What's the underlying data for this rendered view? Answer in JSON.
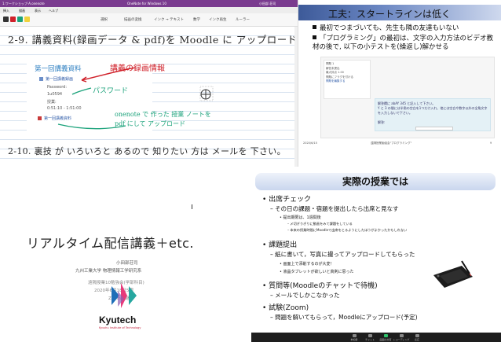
{
  "onenote": {
    "title_left": "1.ワークショップ-A.onenote",
    "title_mid": "OneNote for Windows 10",
    "title_right": "小田部 荘司",
    "menu": [
      "挿入",
      "描画",
      "表示",
      "ヘルプ"
    ],
    "ribbon": [
      "選択",
      "描画の変換",
      "インク → テキスト",
      "数学",
      "インク再生",
      "ルーラー"
    ],
    "handwriting_line1": "2-9. 講義資料(録画データ & pdf)を Moodle に アップロード",
    "handwriting_line2": "2-10. 裏技 が いろいろと あるので 知りたい 方は メールを 下さい。",
    "submission": {
      "title": "第一回講義資料",
      "link1": "第一回講義録画",
      "password_label": "Password:",
      "password_value": "1u0594",
      "lecture_label": "授業:",
      "time": "0:51:10 - 1:51:00",
      "link2": "第一回講義資料"
    },
    "annotations": {
      "red": "講義の録画情報",
      "green1": "パスワード",
      "green2": "onenote で 作った 授業 ノートを",
      "green3": "pdf にして アップロード"
    }
  },
  "slide1": {
    "title": "工夫：スタートラインは低く",
    "bullets": [
      "最初でつまづいても、先生も隣の友達もいない",
      "「プログラミング」の最初は、文字の入力方法のビデオ教材の後で, 以下の小テストを(繰返し)解かせる"
    ],
    "quiz_info": [
      "問題 1",
      "解答未提出",
      "最大評点 1.00",
      "問題にフラグを付ける",
      "問題を編集する"
    ],
    "quiz_text": "解答欄に abAY 345 と記入して下さい。",
    "quiz_text2": "Y と 3 の間には半角の空白を1つだけ入れ、他には空白や数字以外の全角文字を入力しないで下さい。",
    "quiz_answer_label": "解答:",
    "footer_date": "2020/6/15",
    "footer_title": "遠隔授業勉強会\"プログラミング\"",
    "footer_page": "9"
  },
  "slide2": {
    "title": "リアルタイム配信講義＋etc.",
    "author": "小田部荘司",
    "affiliation": "九州工業大学  物理情報工学研究系",
    "event": "遠隔授業10勉強会(学部科目)",
    "date": "2020年6月18日5限",
    "venue": "Zoom中継",
    "logo_name": "Kyutech",
    "logo_sub": "Kyushu Institute of Technology"
  },
  "slide3": {
    "title": "実際の授業では",
    "items": [
      {
        "level": 1,
        "text": "• 出席チェック"
      },
      {
        "level": 2,
        "text": "– その日の課題・宿題を提出したら出席と見なす"
      },
      {
        "level": 3,
        "text": "• 提出期限は、1週間後"
      },
      {
        "level": 4,
        "text": "– 〆切ぎりぎりに動画をみて課題をしている"
      },
      {
        "level": 4,
        "text": "– 本来の授業時間にMoodleで出席をとるようにしたほうがよかったかもしれない"
      },
      {
        "level": 1,
        "text": "• 課題提出"
      },
      {
        "level": 2,
        "text": "– 紙に書いて，写真に撮ってアップロードしてもらった"
      },
      {
        "level": 3,
        "text": "• 画面上で添削するのが大変！"
      },
      {
        "level": 3,
        "text": "• 液晶タブレットが欲しいと真剣に思った"
      },
      {
        "level": 1,
        "text": "• 質問等(Moodleのチャットで待機)"
      },
      {
        "level": 2,
        "text": "– メールでしかこなかった"
      },
      {
        "level": 1,
        "text": "• 試験(Zoom)"
      },
      {
        "level": 2,
        "text": "– 問題を解いてもらって，Moodleにアップロード(予定)"
      }
    ],
    "zoom_bar": [
      "参加者",
      "チャット",
      "画面の共有",
      "レコーディング",
      "反応"
    ]
  },
  "colors": {
    "onenote_purple": "#7a3b8f",
    "annotation_red": "#d0212a",
    "annotation_green": "#1aa27a",
    "link_blue": "#2d7fc1"
  }
}
